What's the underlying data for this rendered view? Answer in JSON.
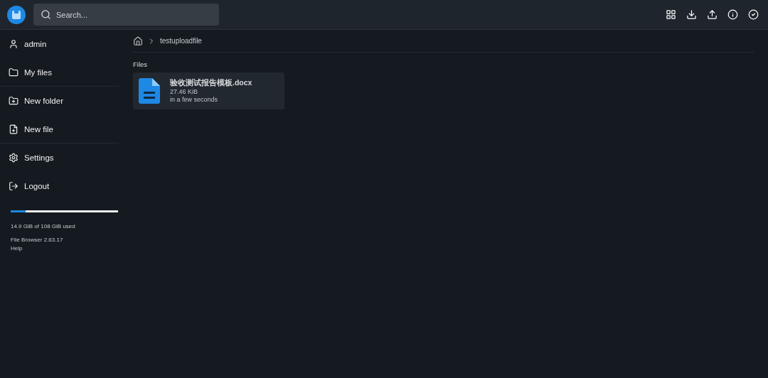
{
  "header": {
    "search": {
      "placeholder": "Search..."
    }
  },
  "sidebar": {
    "items": [
      {
        "label": "admin",
        "divider": false
      },
      {
        "label": "My files",
        "divider": true
      },
      {
        "label": "New folder",
        "divider": false
      },
      {
        "label": "New file",
        "divider": true
      },
      {
        "label": "Settings",
        "divider": false
      },
      {
        "label": "Logout",
        "divider": false
      }
    ],
    "storage": {
      "level": 0.138,
      "text": "14.9 GiB of 108 GiB used"
    },
    "footer": [
      "File Browser 2.63.17",
      "Help"
    ]
  },
  "breadcrumb": {
    "path": "testuploadfile"
  },
  "files": {
    "heading": "Files",
    "items": [
      {
        "name": "验收测试报告模板.docx",
        "size": "27.46 KiB",
        "modified": "in a few seconds"
      }
    ]
  }
}
